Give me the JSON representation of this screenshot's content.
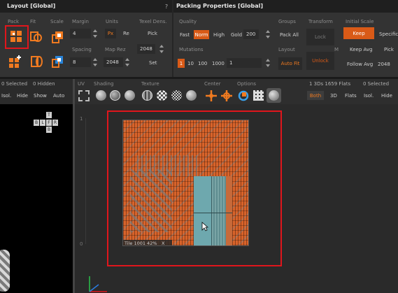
{
  "layout_panel": {
    "title": "Layout [Global]",
    "headers": {
      "pack": "Pack",
      "fit": "Fit",
      "scale": "Scale",
      "margin": "Margin",
      "units": "Units",
      "texel": "Texel Dens."
    },
    "margin_value": "4",
    "units_px": "Px",
    "units_re": "Re",
    "pick_label": "Pick",
    "texel_value": "2048",
    "spacing_label": "Spacing",
    "spacing_value": "8",
    "map_rez_label": "Map Rez",
    "map_rez_value": "2048",
    "set_label": "Set",
    "question": "?"
  },
  "packing_panel": {
    "title": "Packing Properties [Global]",
    "quality_label": "Quality",
    "quality_options": [
      "Fast",
      "Norm",
      "High",
      "Gold"
    ],
    "quality_value": "200",
    "groups_label": "Groups",
    "pack_all": "Pack All",
    "transform_label": "Transform",
    "lock": "Lock",
    "initial_scale_label": "Initial Scale",
    "keep": "Keep",
    "specific": "Specific",
    "mutations_label": "Mutations",
    "mutation_options": [
      "1",
      "10",
      "100",
      "1000"
    ],
    "mutation_value": "1",
    "layout_label": "Layout",
    "auto_fit": "Auto Fit",
    "unlock": "Unlock",
    "m_label": "M",
    "keep_avg": "Keep Avg",
    "pick": "Pick",
    "follow_avg": "Follow Avg",
    "follow_avg_value": "2048"
  },
  "left_pane": {
    "selected": "0 Selected",
    "hidden": "0 Hidden",
    "buttons": [
      "Isol.",
      "Hide",
      "Show",
      "Auto"
    ],
    "view_cube": {
      "top": "T",
      "left": "L",
      "back": "B",
      "front": "F",
      "right": "R",
      "bottom": "B"
    }
  },
  "uv_toolbar": {
    "uv_label": "UV",
    "shading_label": "Shading",
    "texture_label": "Texture",
    "center_label": "Center",
    "options_label": "Options",
    "stats": "1 3Ds 1659 Flats",
    "selected": "0 Selected",
    "filters": [
      "Both",
      "3D",
      "Flats",
      "Isol.",
      "Hide"
    ]
  },
  "viewport": {
    "axis_top": "1",
    "axis_bottom": "0",
    "tile_label": "Tile 1001 42%",
    "tile_close": "X"
  },
  "colors": {
    "accent": "#f07a20",
    "highlight_red": "#e0161c",
    "panel_bg": "#333333",
    "title_bg": "#1f1f1f",
    "uv_orange": "#d8632a",
    "uv_teal": "#6ea8ae"
  }
}
